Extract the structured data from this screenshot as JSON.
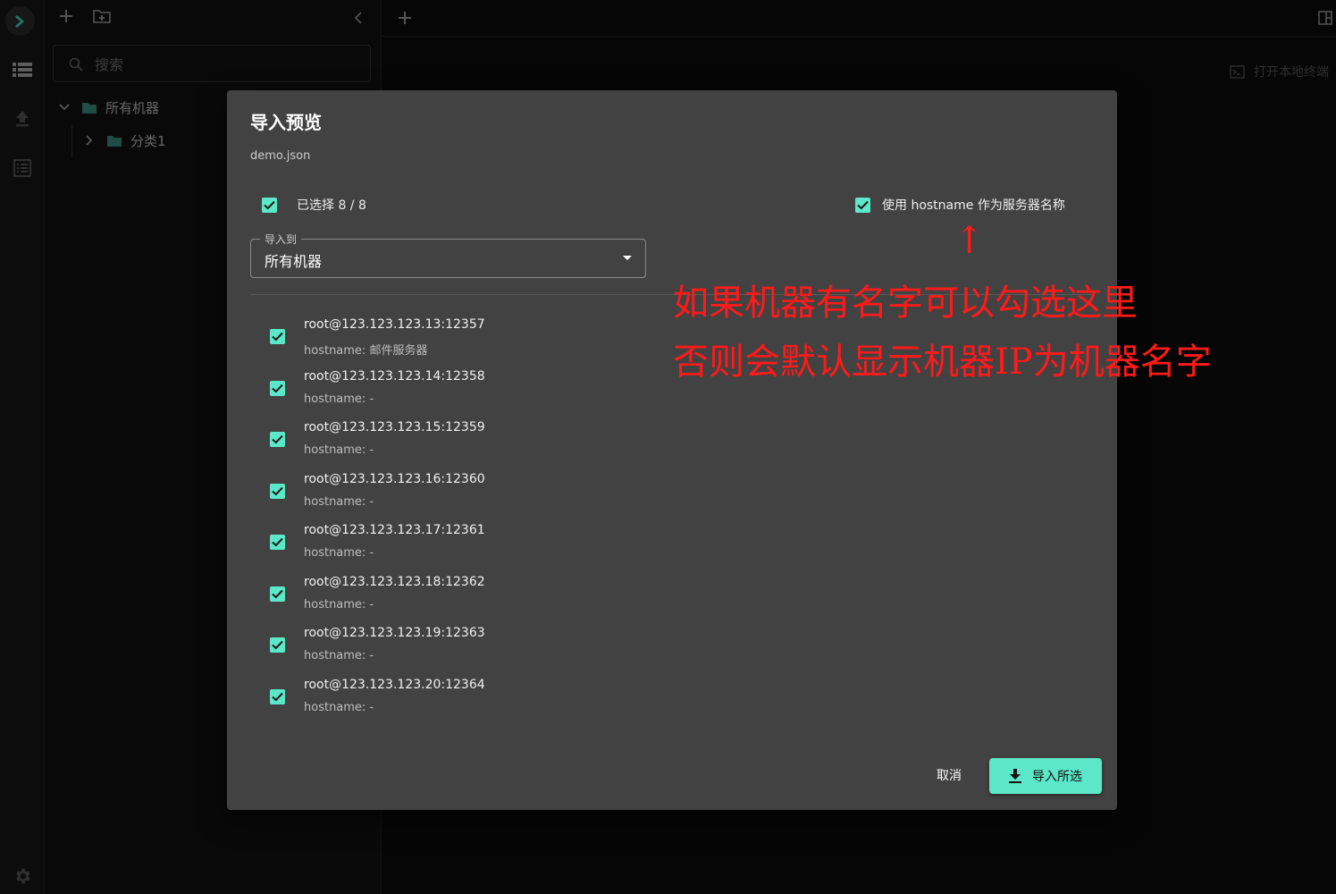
{
  "sidebar": {
    "search_placeholder": "搜索",
    "tree": [
      {
        "label": "所有机器"
      },
      {
        "label": "分类1"
      }
    ]
  },
  "main": {
    "local_terminal_label": "打开本地终端"
  },
  "dialog": {
    "title": "导入预览",
    "filename": "demo.json",
    "selected_label": "已选择 8 / 8",
    "use_hostname_label": "使用 hostname 作为服务器名称",
    "target_label": "导入到",
    "target_value": "所有机器",
    "items": [
      {
        "addr": "root@123.123.123.13:12357",
        "hostname": "hostname: 邮件服务器"
      },
      {
        "addr": "root@123.123.123.14:12358",
        "hostname": "hostname: -"
      },
      {
        "addr": "root@123.123.123.15:12359",
        "hostname": "hostname: -"
      },
      {
        "addr": "root@123.123.123.16:12360",
        "hostname": "hostname: -"
      },
      {
        "addr": "root@123.123.123.17:12361",
        "hostname": "hostname: -"
      },
      {
        "addr": "root@123.123.123.18:12362",
        "hostname": "hostname: -"
      },
      {
        "addr": "root@123.123.123.19:12363",
        "hostname": "hostname: -"
      },
      {
        "addr": "root@123.123.123.20:12364",
        "hostname": "hostname: -"
      }
    ],
    "cancel_label": "取消",
    "import_label": "导入所选"
  },
  "annotation": {
    "arrow": "↑",
    "line1": "如果机器有名字可以勾选这里",
    "line2": "否则会默认显示机器IP为机器名字"
  },
  "colors": {
    "accent": "#5ce8c8",
    "dialog_bg": "#424242",
    "annotation": "#ff1a1a"
  }
}
